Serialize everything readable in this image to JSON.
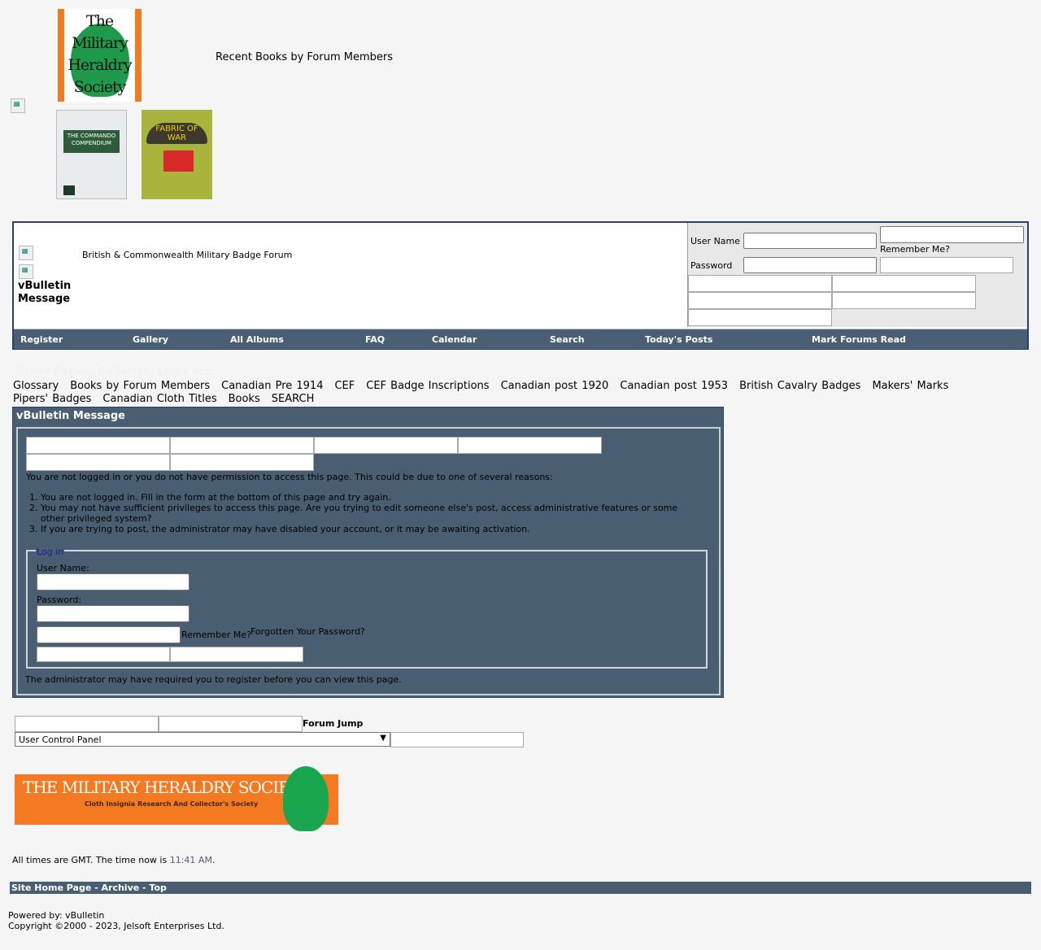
{
  "header": {
    "logo_text": "The Military Heraldry Society",
    "recent_books_label": "Recent Books by Forum Members",
    "books": [
      {
        "title": "THE COMMANDO COMPENDIUM"
      },
      {
        "title": "FABRIC OF WAR"
      }
    ]
  },
  "navbar": {
    "forum_title": "British & Commonwealth Military Badge Forum",
    "breadcrumb_title": "vBulletin Message",
    "login": {
      "username_label": "User Name",
      "password_label": "Password",
      "remember_label": "Remember Me?"
    },
    "links": [
      "Register",
      "Gallery",
      "All Albums",
      "FAQ",
      "Calendar",
      "Search",
      "Today's Posts",
      "Mark Forums Read"
    ]
  },
  "other_pages": {
    "heading": "Other Pages, Galleries, Links etc.",
    "links": [
      "Glossary",
      "Books by Forum Members",
      "Canadian Pre 1914",
      "CEF",
      "CEF Badge Inscriptions",
      "Canadian post 1920",
      "Canadian post 1953",
      "British Cavalry Badges",
      "Makers' Marks",
      "Pipers' Badges",
      "Canadian Cloth Titles",
      "Books",
      "SEARCH"
    ]
  },
  "message": {
    "title": "vBulletin Message",
    "intro": "You are not logged in or you do not have permission to access this page. This could be due to one of several reasons:",
    "reasons": [
      "You are not logged in. Fill in the form at the bottom of this page and try again.",
      "You may not have sufficient privileges to access this page. Are you trying to edit someone else's post, access administrative features or some other privileged system?",
      "If you are trying to post, the administrator may have disabled your account, or it may be awaiting activation."
    ],
    "login_legend": "Log in",
    "username_label": "User Name:",
    "password_label": "Password:",
    "remember_label": "Remember Me?",
    "forgot_label": "Forgotten Your Password?",
    "footer_note": "The administrator may have required you to register before you can view this page."
  },
  "forum_jump": {
    "label": "Forum Jump",
    "selected": "User Control Panel"
  },
  "banner": {
    "title": "THE MILITARY HERALDRY SOCIETY",
    "subtitle": "Cloth Insignia Research And Collector's Society"
  },
  "footer": {
    "times_prefix": "All times are GMT. The time now is",
    "time": "11:41 AM",
    "times_suffix": ".",
    "nav": "Site Home Page - Archive - Top",
    "powered": "Powered by: vBulletin",
    "copyright": "Copyright ©2000 - 2023, Jelsoft Enterprises Ltd."
  }
}
